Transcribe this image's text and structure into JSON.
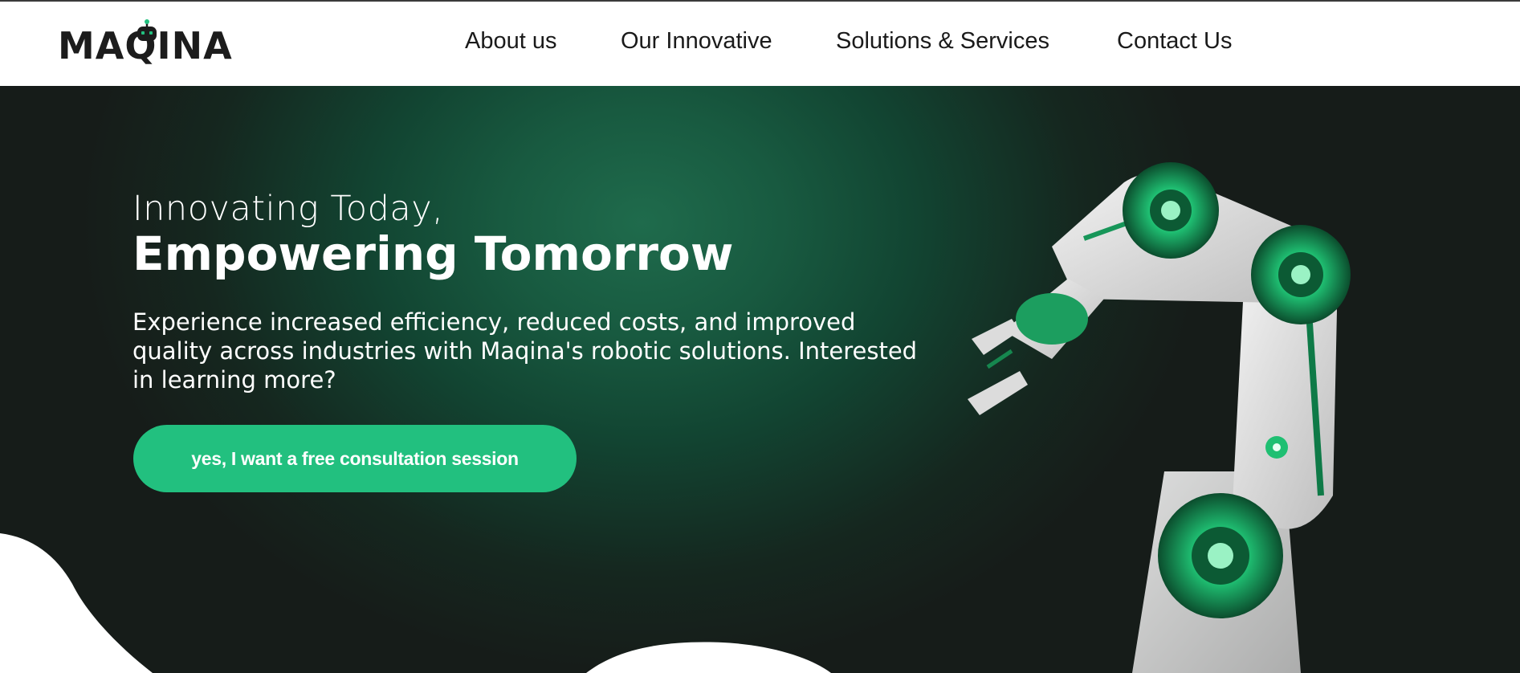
{
  "brand": {
    "logo_text": "MAQINA"
  },
  "nav": {
    "items": [
      {
        "label": "About us"
      },
      {
        "label": "Our Innovative"
      },
      {
        "label": "Solutions & Services"
      },
      {
        "label": "Contact Us"
      }
    ]
  },
  "hero": {
    "headline_light": "Innovating Today,",
    "headline_bold": "Empowering Tomorrow",
    "lead_line_1": "Experience increased efficiency, reduced costs, and improved",
    "lead_line_2": "quality across industries with Maqina's robotic solutions. Interested",
    "lead_line_3": "in learning more?",
    "cta_label": "yes, I want a free consultation session"
  },
  "colors": {
    "accent": "#22c07f",
    "hero_dark": "#161c19",
    "hero_glow": "#1f6b4c",
    "text_dark": "#1a1a1a"
  },
  "icons": {
    "logo_mark": "robot-head-icon",
    "hero_image": "robotic-arm-image"
  }
}
